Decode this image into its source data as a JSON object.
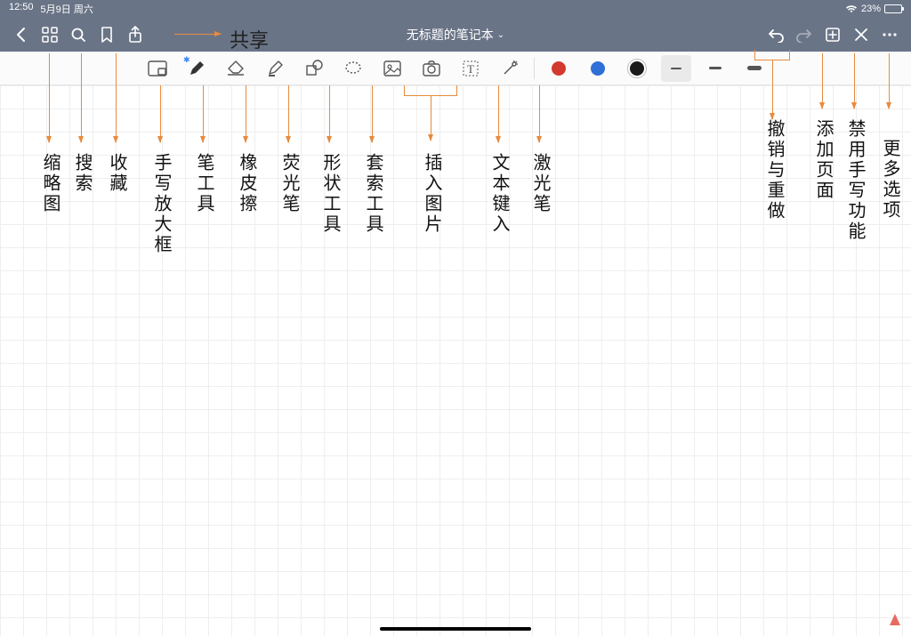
{
  "status": {
    "time": "12:50",
    "date": "5月9日 周六",
    "battery_pct": "23%"
  },
  "topbar": {
    "title": "无标题的笔记本",
    "chevron": "⌄",
    "share_annotation": "共享"
  },
  "icons": {
    "back": "back-icon",
    "thumbnails": "thumbnails-icon",
    "search": "search-icon",
    "bookmark": "bookmark-icon",
    "share": "share-icon",
    "undo": "undo-icon",
    "redo": "redo-icon",
    "addpage": "add-page-icon",
    "close": "close-icon",
    "more": "more-icon"
  },
  "tools": {
    "zoombox": "手写放大框",
    "pen": "笔工具",
    "eraser": "橡皮擦",
    "highlighter": "荧光笔",
    "shape": "形状工具",
    "lasso": "套索工具",
    "image": "插入图片",
    "camera": "camera",
    "text": "文本键入",
    "laser": "激光笔"
  },
  "colors": {
    "red": "#d33a2f",
    "blue": "#2f6fd6",
    "black": "#1a1a1a"
  },
  "annotations": {
    "thumbnails": "缩略图",
    "search": "搜索",
    "bookmark": "收藏",
    "zoombox": "手写放大框",
    "pen": "笔工具",
    "eraser": "橡皮擦",
    "highlighter": "荧光笔",
    "shape": "形状工具",
    "lasso": "套索工具",
    "image": "插入图片",
    "text": "文本键入",
    "laser": "激光笔",
    "undo_redo": "撤销与重做",
    "addpage": "添加页面",
    "disable_hw": "禁用手写功能",
    "more": "更多选项"
  }
}
